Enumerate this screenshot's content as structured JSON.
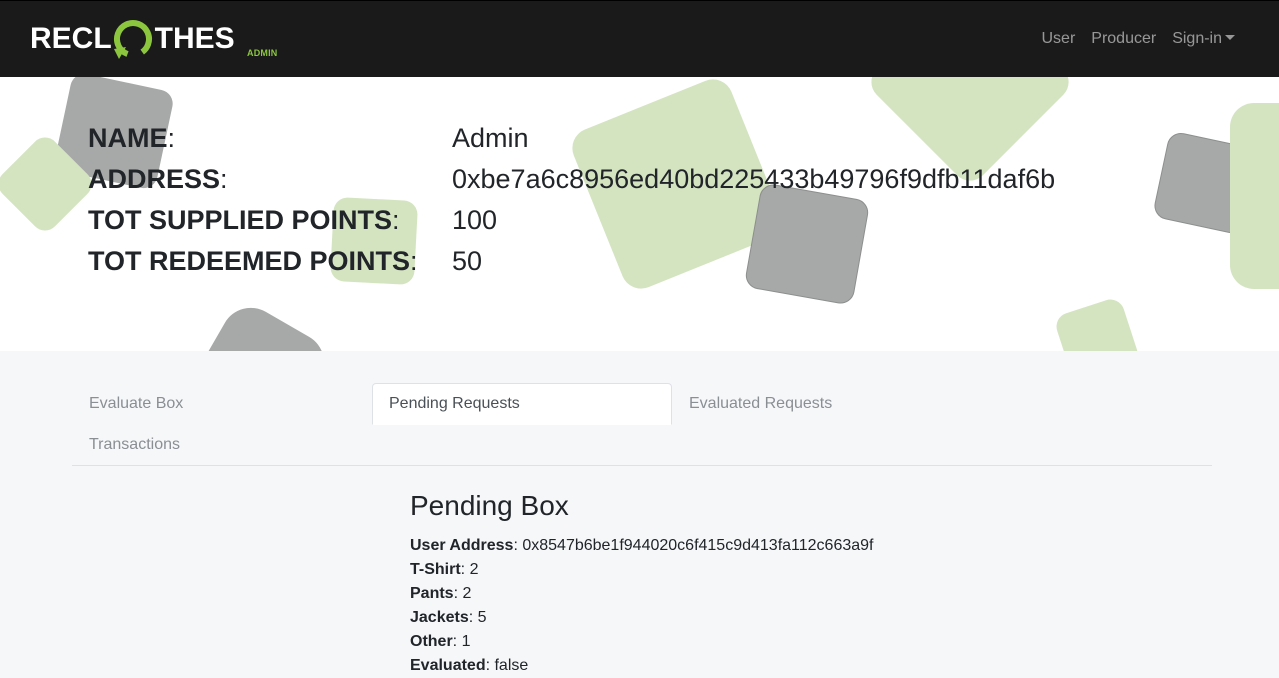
{
  "navbar": {
    "brand_left": "RECL",
    "brand_right": "THES",
    "brand_sub": "ADMIN",
    "links": [
      "User",
      "Producer",
      "Sign-in"
    ],
    "brand_color": "#8cc63f"
  },
  "profile": {
    "rows": [
      {
        "label": "NAME",
        "value": "Admin"
      },
      {
        "label": "ADDRESS",
        "value": "0xbe7a6c8956ed40bd225433b49796f9dfb11daf6b"
      },
      {
        "label": "TOT SUPPLIED POINTS",
        "value": "100"
      },
      {
        "label": "TOT REDEEMED POINTS",
        "value": "50"
      }
    ]
  },
  "tabs": [
    "Evaluate Box",
    "Pending Requests",
    "Evaluated Requests",
    "Transactions"
  ],
  "active_tab": "Pending Requests",
  "pending": {
    "title": "Pending Box",
    "fields": [
      {
        "label": "User Address",
        "value": "0x8547b6be1f944020c6f415c9d413fa112c663a9f"
      },
      {
        "label": "T-Shirt",
        "value": "2"
      },
      {
        "label": "Pants",
        "value": "2"
      },
      {
        "label": "Jackets",
        "value": "5"
      },
      {
        "label": "Other",
        "value": "1"
      },
      {
        "label": "Evaluated",
        "value": "false"
      }
    ]
  }
}
